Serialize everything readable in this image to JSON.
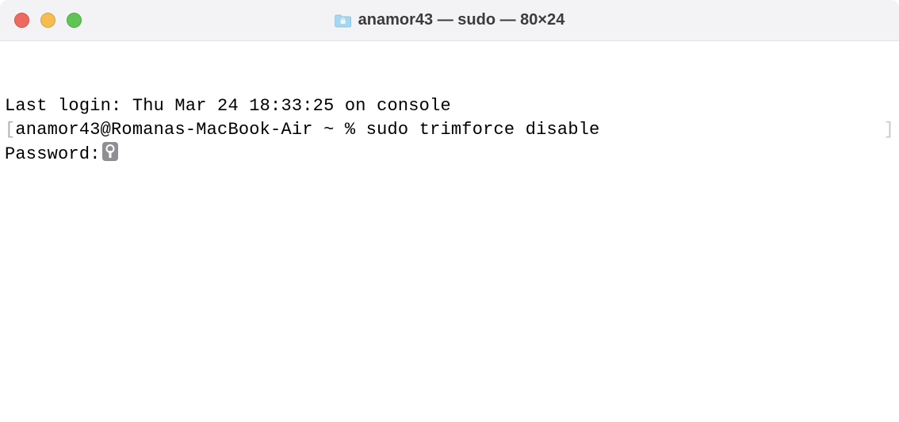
{
  "titlebar": {
    "title": "anamor43 — sudo — 80×24"
  },
  "terminal": {
    "last_login": "Last login: Thu Mar 24 18:33:25 on console",
    "prompt_open_bracket": "[",
    "prompt": "anamor43@Romanas-MacBook-Air ~ % ",
    "command": "sudo trimforce disable",
    "prompt_close_bracket": "]",
    "password_label": "Password:"
  }
}
